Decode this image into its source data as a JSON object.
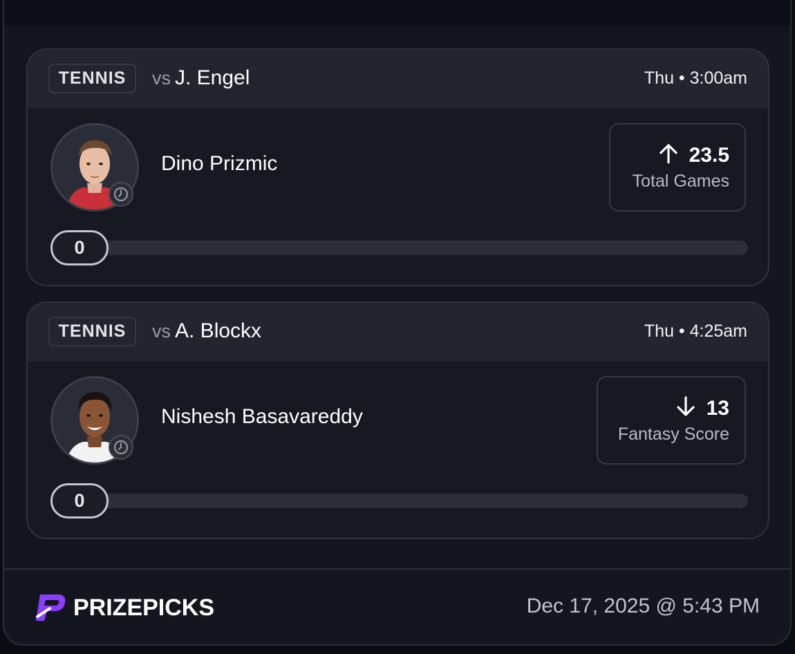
{
  "cards": [
    {
      "sport": "TENNIS",
      "vs_word": "vs",
      "opponent": "J. Engel",
      "when": "Thu • 3:00am",
      "player": "Dino Prizmic",
      "direction": "up",
      "line": "23.5",
      "stat": "Total Games",
      "progress": "0",
      "progress_fraction": 0
    },
    {
      "sport": "TENNIS",
      "vs_word": "vs",
      "opponent": "A. Blockx",
      "when": "Thu • 4:25am",
      "player": "Nishesh Basavareddy",
      "direction": "down",
      "line": "13",
      "stat": "Fantasy Score",
      "progress": "0",
      "progress_fraction": 0
    }
  ],
  "footer": {
    "brand": "PRIZEPICKS",
    "timestamp": "Dec 17, 2025 @ 5:43 PM"
  },
  "colors": {
    "background": "#0a0c14",
    "panel": "#14161f",
    "card": "#161822",
    "card_header": "#22242f",
    "brand_purple": "#8b3dff"
  },
  "icons": {
    "avatar_overlay": "clock-icon",
    "more_direction": "arrow-up-icon",
    "less_direction": "arrow-down-icon",
    "brand_mark": "prizepicks-logo-icon"
  }
}
